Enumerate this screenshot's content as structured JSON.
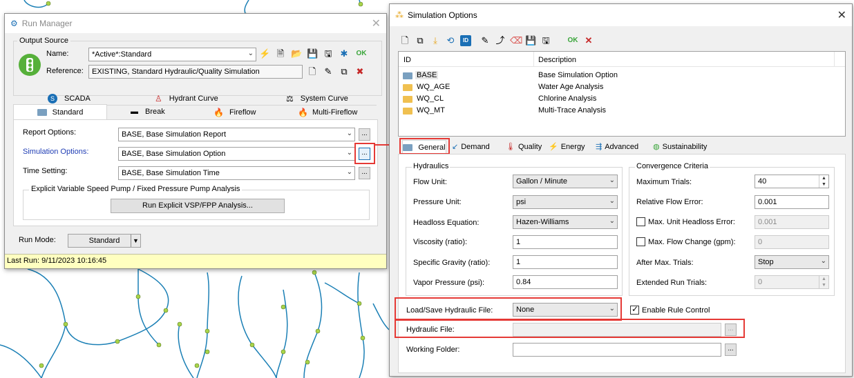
{
  "run_manager": {
    "title": "Run Manager",
    "output_source_label": "Output Source",
    "name_label": "Name:",
    "name_value": "*Active*:Standard",
    "reference_label": "Reference:",
    "reference_value": "EXISTING, Standard Hydraulic/Quality Simulation",
    "tabs_row1": [
      "SCADA",
      "Hydrant Curve",
      "System Curve"
    ],
    "tabs_row2": [
      "Standard",
      "Break",
      "Fireflow",
      "Multi-Fireflow"
    ],
    "report_options_label": "Report Options:",
    "report_options_value": "BASE, Base Simulation Report",
    "simulation_options_label": "Simulation Options:",
    "simulation_options_value": "BASE, Base Simulation Option",
    "time_setting_label": "Time Setting:",
    "time_setting_value": "BASE, Base Simulation Time",
    "vsp_group_label": "Explicit Variable Speed Pump / Fixed Pressure Pump Analysis",
    "vsp_button": "Run Explicit VSP/FPP Analysis...",
    "run_mode_label": "Run Mode:",
    "run_mode_value": "Standard",
    "status": "Last Run: 9/11/2023 10:16:45",
    "ok_label": "OK",
    "dots": "..."
  },
  "sim_options": {
    "title": "Simulation Options",
    "ok_label": "OK",
    "columns": [
      "ID",
      "Description"
    ],
    "rows": [
      {
        "id": "BASE",
        "desc": "Base Simulation Option"
      },
      {
        "id": "WQ_AGE",
        "desc": "Water Age Analysis"
      },
      {
        "id": "WQ_CL",
        "desc": "Chlorine Analysis"
      },
      {
        "id": "WQ_MT",
        "desc": "Multi-Trace Analysis"
      }
    ],
    "tabs": [
      "General",
      "Demand",
      "Quality",
      "Energy",
      "Advanced",
      "Sustainability"
    ],
    "hydraulics": {
      "group": "Hydraulics",
      "flow_unit_label": "Flow Unit:",
      "flow_unit": "Gallon / Minute",
      "pressure_unit_label": "Pressure Unit:",
      "pressure_unit": "psi",
      "headloss_label": "Headloss Equation:",
      "headloss": "Hazen-Williams",
      "viscosity_label": "Viscosity (ratio):",
      "viscosity": "1",
      "sg_label": "Specific Gravity (ratio):",
      "sg": "1",
      "vapor_label": "Vapor Pressure (psi):",
      "vapor": "0.84"
    },
    "convergence": {
      "group": "Convergence Criteria",
      "max_trials_label": "Maximum Trials:",
      "max_trials": "40",
      "rel_flow_label": "Relative Flow Error:",
      "rel_flow": "0.001",
      "max_headloss_label": "Max. Unit Headloss Error:",
      "max_headloss": "0.001",
      "max_flow_change_label": "Max. Flow Change (gpm):",
      "max_flow_change": "0",
      "after_max_label": "After Max. Trials:",
      "after_max": "Stop",
      "extended_label": "Extended Run Trials:",
      "extended": "0"
    },
    "load_save_label": "Load/Save Hydraulic File:",
    "load_save_value": "None",
    "enable_rule_label": "Enable Rule Control",
    "hydraulic_file_label": "Hydraulic File:",
    "hydraulic_file_value": "",
    "working_folder_label": "Working Folder:",
    "working_folder_value": "",
    "dots": "..."
  }
}
